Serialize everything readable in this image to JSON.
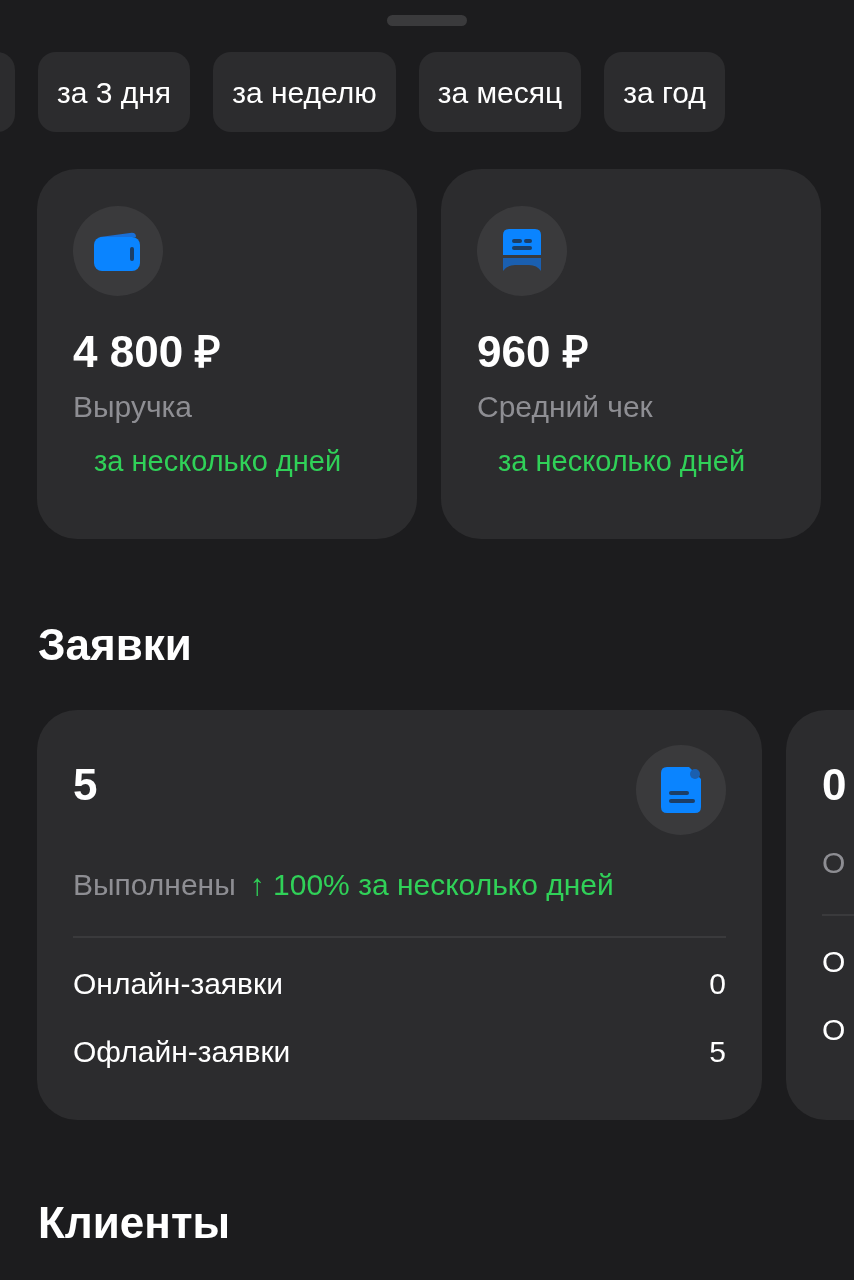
{
  "periods": [
    {
      "label": "за 3 дня"
    },
    {
      "label": "за неделю"
    },
    {
      "label": "за месяц"
    },
    {
      "label": "за год"
    }
  ],
  "metrics": [
    {
      "value": "4 800 ₽",
      "label": "Выручка",
      "trend": "за несколько дней"
    },
    {
      "value": "960 ₽",
      "label": "Средний чек",
      "trend": "за несколько дней"
    }
  ],
  "orders": {
    "title": "Заявки",
    "cards": [
      {
        "value": "5",
        "label": "Выполнены",
        "trend": "↑ 100% за несколько дней",
        "rows": [
          {
            "label": "Онлайн-заявки",
            "value": "0"
          },
          {
            "label": "Офлайн-заявки",
            "value": "5"
          }
        ]
      },
      {
        "value": "0",
        "label": "О",
        "rows": [
          {
            "label": "О"
          },
          {
            "label": "О"
          }
        ]
      }
    ]
  },
  "clients": {
    "title": "Клиенты"
  }
}
